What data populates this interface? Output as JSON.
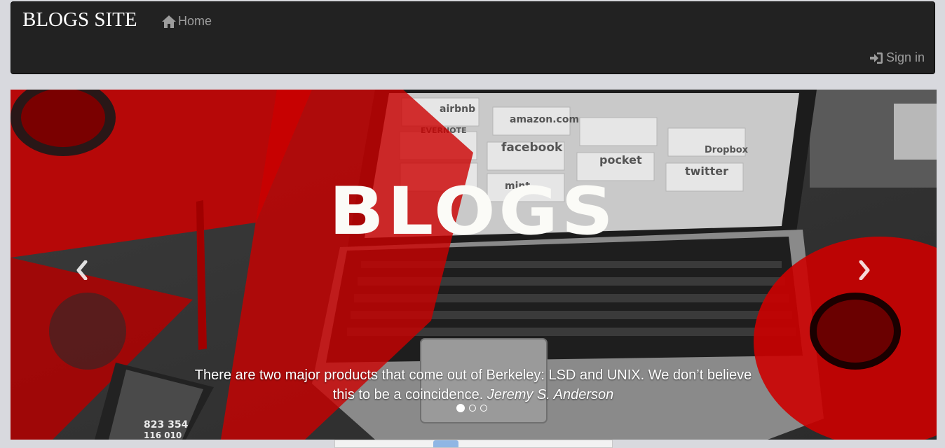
{
  "navbar": {
    "brand": "BLOGS SITE",
    "home_label": "Home",
    "home_icon": "home-icon",
    "signin_label": "Sign in",
    "signin_icon": "log-in-icon"
  },
  "carousel": {
    "hero_title": "BLOGS",
    "laptop_apps": [
      "airbnb",
      "amazon.com",
      "EVERNOTE",
      "facebook",
      "Dropbox",
      "pocket",
      "twitter",
      "mint"
    ],
    "caption_quote": "There are two major products that come out of Berkeley: LSD and UNIX. We don’t believe this to be a coincidence.",
    "caption_author": "Jeremy S. Anderson",
    "prev_icon": "chevron-left-icon",
    "next_icon": "chevron-right-icon",
    "slide_count": 3,
    "active_slide": 1,
    "phone_numbers": [
      "823 354",
      "116 010"
    ]
  },
  "colors": {
    "navbar_bg": "#222222",
    "brand_text": "#ffffff",
    "nav_text": "#9d9d9d",
    "accent_red": "#cc0000",
    "page_bg": "#d8d9de"
  }
}
